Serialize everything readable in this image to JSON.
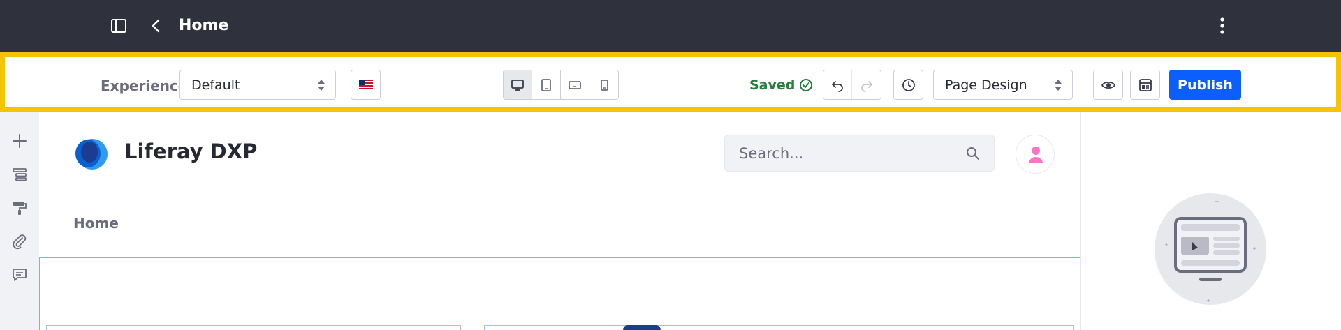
{
  "header": {
    "title": "Home",
    "icons": [
      "sidebar-toggle-icon",
      "chevron-left-icon",
      "ellipsis-vertical-icon"
    ]
  },
  "toolbar": {
    "experience_label": "Experience",
    "experience_value": "Default",
    "language_flag": "en-US",
    "devices": [
      "desktop",
      "tablet",
      "landscape-phone",
      "portrait-phone"
    ],
    "active_device": "desktop",
    "status": "Saved",
    "mode_value": "Page Design",
    "publish_label": "Publish"
  },
  "rail": {
    "items": [
      "plus-icon",
      "page-structure-icon",
      "format-painter-icon",
      "paperclip-icon",
      "comments-icon"
    ]
  },
  "site": {
    "name": "Liferay DXP",
    "search_placeholder": "Search...",
    "nav": [
      "Home"
    ]
  },
  "colors": {
    "topbar": "#2f313d",
    "highlight": "#f5c400",
    "primary": "#0b5fff",
    "success": "#287d3c",
    "avatar": "#ff73c3"
  }
}
